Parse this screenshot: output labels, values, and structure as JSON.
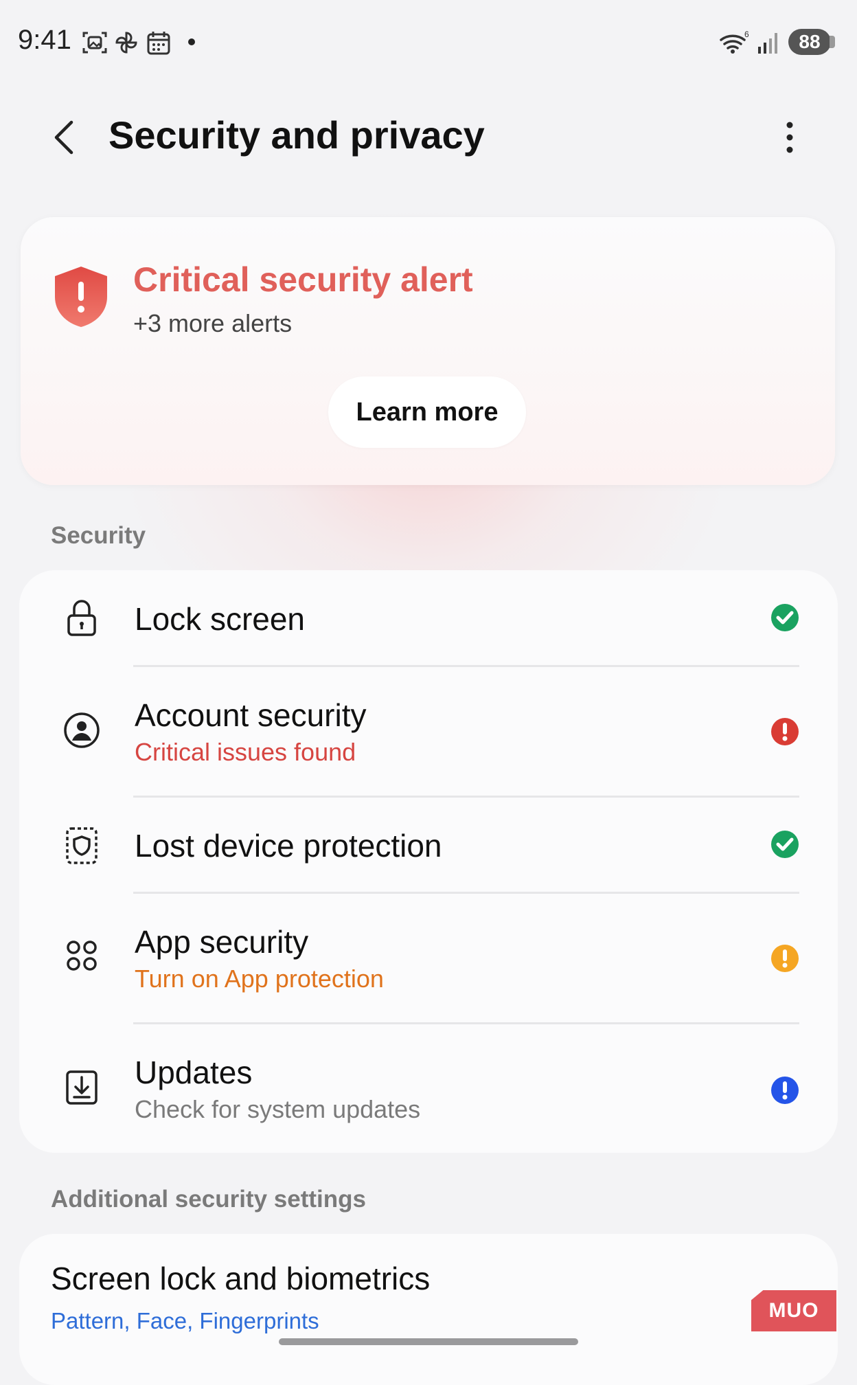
{
  "status_bar": {
    "time": "9:41",
    "wifi_label": "6",
    "battery": "88"
  },
  "header": {
    "title": "Security and privacy"
  },
  "alert": {
    "title": "Critical security alert",
    "subtitle": "+3 more alerts",
    "button_label": "Learn more",
    "accent_color": "#e0605a"
  },
  "security_section": {
    "label": "Security",
    "items": [
      {
        "icon": "lock-icon",
        "title": "Lock screen",
        "subtitle": "",
        "status": "ok",
        "status_color": "#1aa260"
      },
      {
        "icon": "account-icon",
        "title": "Account security",
        "subtitle": "Critical issues found",
        "subtitle_color": "#d64541",
        "status": "critical",
        "status_color": "#d93c34"
      },
      {
        "icon": "lost-device-icon",
        "title": "Lost device protection",
        "subtitle": "",
        "status": "ok",
        "status_color": "#1aa260"
      },
      {
        "icon": "apps-icon",
        "title": "App security",
        "subtitle": "Turn on App protection",
        "subtitle_color": "#e0731c",
        "status": "warning",
        "status_color": "#f5a623"
      },
      {
        "icon": "download-icon",
        "title": "Updates",
        "subtitle": "Check for system updates",
        "subtitle_color": "#7a7a7a",
        "status": "info",
        "status_color": "#2454e8"
      }
    ]
  },
  "additional_section": {
    "label": "Additional security settings",
    "item_title": "Screen lock and biometrics",
    "item_subtitle": "Pattern, Face, Fingerprints"
  },
  "watermark": "MUO"
}
